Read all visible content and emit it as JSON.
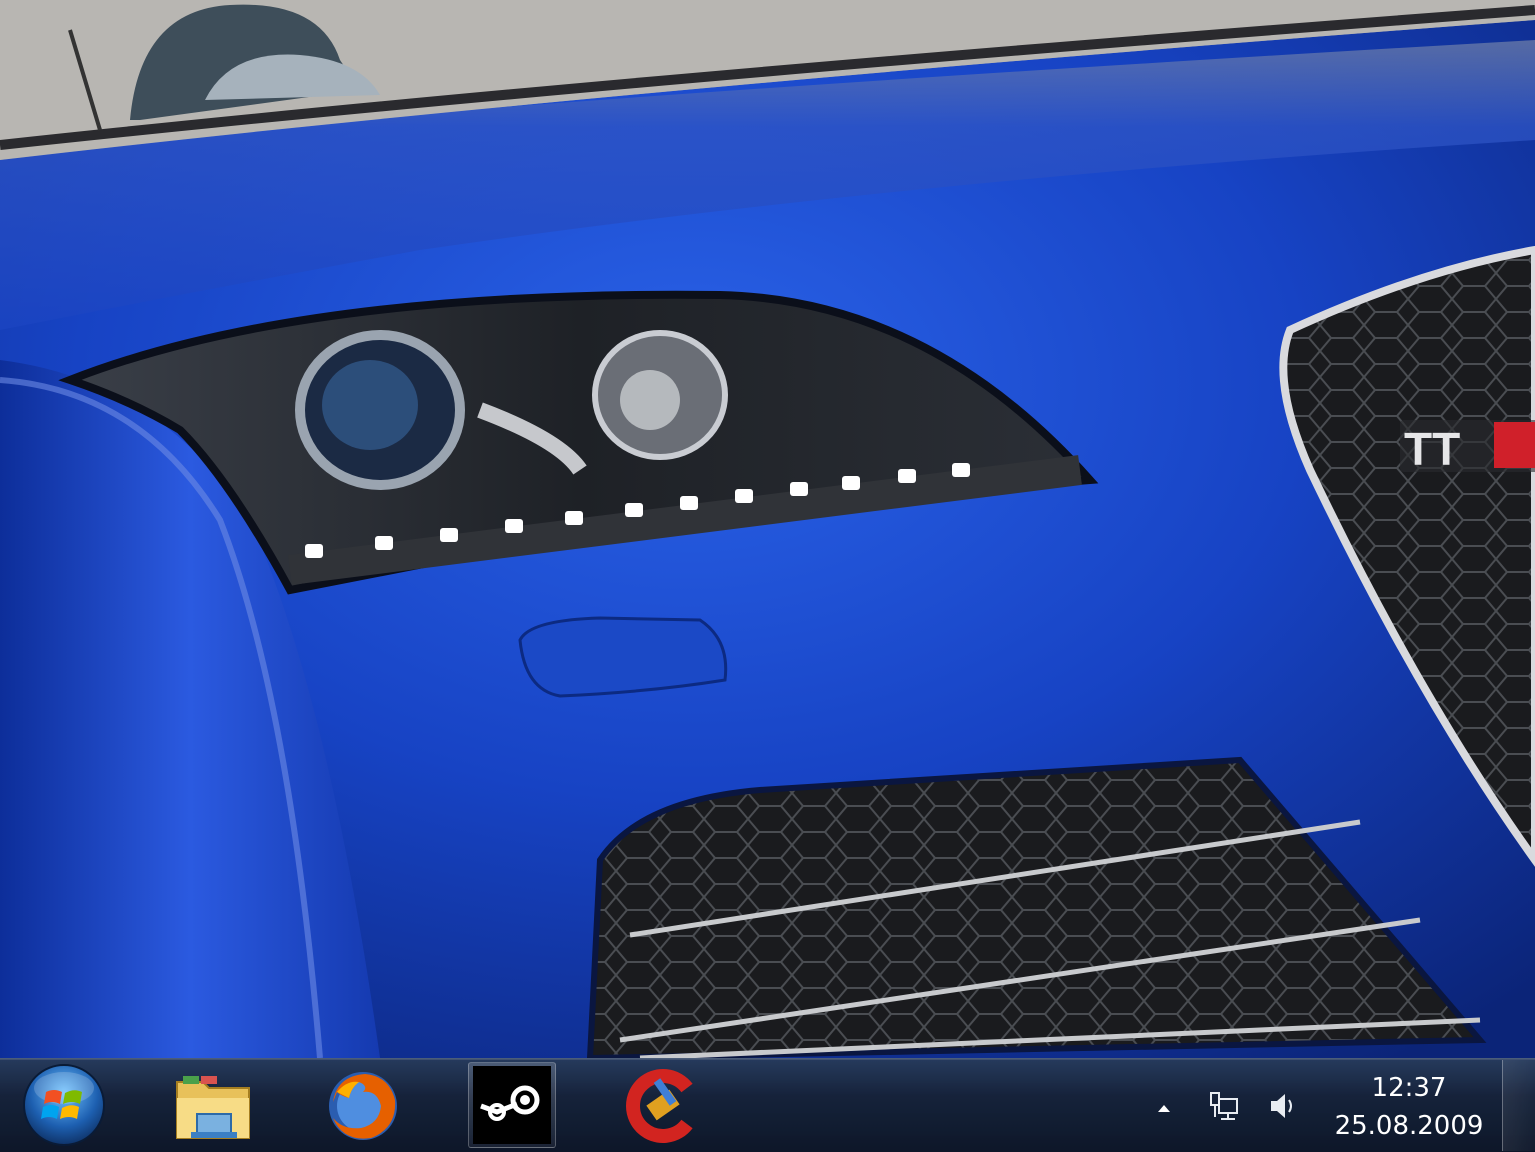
{
  "desktop": {
    "wallpaper_badge": "TTRS"
  },
  "taskbar": {
    "start_icon": "windows-orb-icon",
    "pinned": [
      {
        "id": "explorer",
        "icon": "folder-icon"
      },
      {
        "id": "firefox",
        "icon": "firefox-icon"
      },
      {
        "id": "steam",
        "icon": "steam-icon",
        "active": true
      },
      {
        "id": "ccleaner",
        "icon": "ccleaner-icon"
      }
    ],
    "tray": {
      "show_hidden_icon": "chevron-up-icon",
      "network_icon": "network-icon",
      "volume_icon": "speaker-icon"
    },
    "clock": {
      "time": "12:37",
      "date": "25.08.2009"
    }
  },
  "colors": {
    "car_blue": "#1740b8",
    "taskbar": "#1a2538"
  }
}
